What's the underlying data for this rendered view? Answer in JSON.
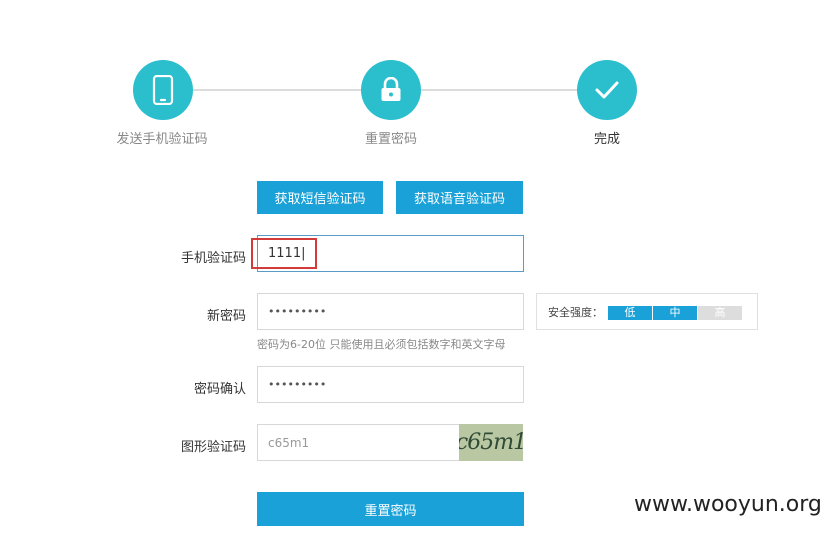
{
  "steps": [
    {
      "label": "发送手机验证码",
      "icon": "phone-icon"
    },
    {
      "label": "重置密码",
      "icon": "lock-icon"
    },
    {
      "label": "完成",
      "icon": "check-icon"
    }
  ],
  "buttons": {
    "sms_code": "获取短信验证码",
    "voice_code": "获取语音验证码",
    "submit": "重置密码"
  },
  "form": {
    "phone_code_label": "手机验证码",
    "phone_code_value": "1111",
    "new_password_label": "新密码",
    "new_password_value": "•••••••••",
    "password_hint": "密码为6-20位 只能使用且必须包括数字和英文字母",
    "confirm_label": "密码确认",
    "confirm_value": "•••••••••",
    "captcha_label": "图形验证码",
    "captcha_value": "c65m1",
    "captcha_image_text": "c65m1"
  },
  "strength": {
    "label": "安全强度：",
    "levels": [
      "低",
      "中",
      "高"
    ],
    "level_active": 2
  },
  "colors": {
    "accent": "#2bbfce",
    "button": "#1aa1d8",
    "strength_on": "#1aa1d8",
    "strength_off": "#dddddd",
    "highlight": "#d33a3a"
  },
  "watermark": "www.wooyun.org"
}
